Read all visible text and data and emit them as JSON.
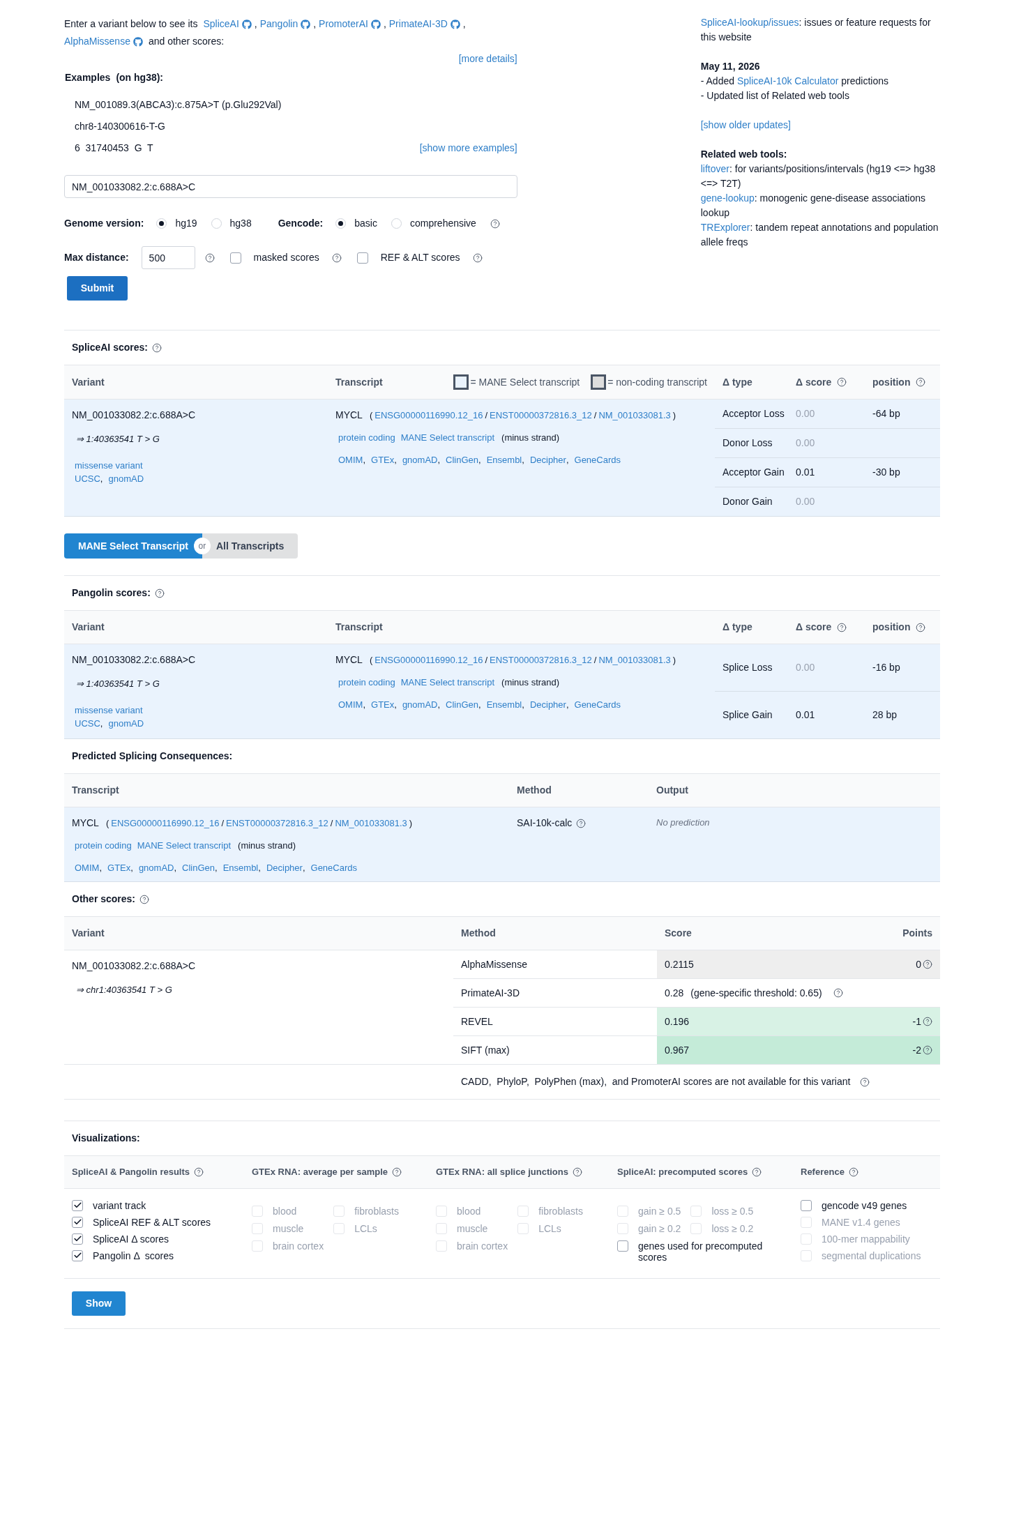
{
  "intro": {
    "lead": "Enter a variant below to see its",
    "tools": [
      {
        "label": "SpliceAI",
        "after": ","
      },
      {
        "label": "Pangolin",
        "after": ","
      },
      {
        "label": "PromoterAI",
        "after": ","
      },
      {
        "label": "PrimateAI-3D",
        "after": ","
      },
      {
        "label": "AlphaMissense"
      }
    ],
    "tail": "and other scores:",
    "more_link": "[more details]"
  },
  "examples": {
    "title": "Examples",
    "note": "(on hg38):",
    "items": [
      "NM_001089.3(ABCA3):c.875A>T (p.Glu292Val)",
      "chr8-140300616-T-G",
      "6  31740453  G  T"
    ],
    "more_link": "[show more examples]"
  },
  "variant_input": {
    "value": "NM_001033082.2:c.688A>C"
  },
  "genome_version": {
    "label": "Genome version:",
    "options": [
      {
        "label": "hg19",
        "selected": true
      },
      {
        "label": "hg38",
        "selected": false
      }
    ]
  },
  "gencode": {
    "label": "Gencode:",
    "options": [
      {
        "label": "basic",
        "selected": true
      },
      {
        "label": "comprehensive",
        "selected": false
      }
    ]
  },
  "max_distance": {
    "label": "Max distance:",
    "value": "500"
  },
  "options": [
    {
      "label": "masked scores",
      "checked": false
    },
    {
      "label": "REF & ALT scores",
      "checked": false
    }
  ],
  "submit": "Submit",
  "sidebar": {
    "issues": {
      "link": "SpliceAI-lookup/issues",
      "text": ": issues or feature requests for this website"
    },
    "update": {
      "date": "May 11, 2026",
      "lines": [
        {
          "prefix": "- Added ",
          "link": "SpliceAI-10k Calculator",
          "suffix": " predictions"
        },
        {
          "prefix": "- Updated list of Related web tools"
        }
      ]
    },
    "older_link": "[show older updates]",
    "related": {
      "title": "Related web tools:",
      "items": [
        {
          "link": "liftover",
          "text": ": for variants/positions/intervals (hg19 <=> hg38 <=> T2T)"
        },
        {
          "link": "gene-lookup",
          "text": ": monogenic gene-disease associations lookup"
        },
        {
          "link": "TRExplorer",
          "text": ": tandem repeat annotations and population allele freqs"
        }
      ]
    }
  },
  "spliceai": {
    "title": "SpliceAI scores:",
    "columns": [
      "Variant",
      "Transcript",
      "Δ type",
      "Δ score",
      "position"
    ],
    "legend": [
      {
        "kind": "mane",
        "label": "= MANE Select transcript"
      },
      {
        "kind": "noncoding",
        "label": "= non-coding transcript"
      }
    ],
    "variant": {
      "name": "NM_001033082.2:c.688A>C",
      "coords": "⇒ 1:40363541 T > G",
      "consequence": "missense variant",
      "links": [
        {
          "label": "UCSC",
          "after": ","
        },
        {
          "label": "gnomAD"
        }
      ]
    },
    "transcript": {
      "gene": "MYCL",
      "open": "(",
      "ids": [
        {
          "label": "ENSG00000116990.12_16",
          "after": "/"
        },
        {
          "label": "ENST00000372816.3_12",
          "after": "/"
        },
        {
          "label": "NM_001033081.3",
          "after": ")"
        }
      ],
      "tags": [
        "protein coding",
        "MANE Select transcript"
      ],
      "strand": "(minus strand)",
      "links": [
        {
          "label": "OMIM",
          "after": ","
        },
        {
          "label": "GTEx",
          "after": ","
        },
        {
          "label": "gnomAD",
          "after": ","
        },
        {
          "label": "ClinGen",
          "after": ","
        },
        {
          "label": "Ensembl",
          "after": ","
        },
        {
          "label": "Decipher",
          "after": ","
        },
        {
          "label": "GeneCards"
        }
      ]
    },
    "rows": [
      {
        "type": "Acceptor Loss",
        "score": "0.00",
        "dim": true,
        "position": "-64 bp"
      },
      {
        "type": "Donor Loss",
        "score": "0.00",
        "dim": true
      },
      {
        "type": "Acceptor Gain",
        "score": "0.01",
        "dim": false,
        "position": "-30 bp"
      },
      {
        "type": "Donor Gain",
        "score": "0.00",
        "dim": true
      }
    ]
  },
  "transcript_toggle": {
    "or": "or",
    "options": [
      {
        "label": "MANE Select Transcript",
        "selected": true
      },
      {
        "label": "All Transcripts",
        "selected": false
      }
    ]
  },
  "pangolin": {
    "title": "Pangolin scores:",
    "columns": [
      "Variant",
      "Transcript",
      "Δ type",
      "Δ score",
      "position"
    ],
    "variant": {
      "name": "NM_001033082.2:c.688A>C",
      "coords": "⇒ 1:40363541 T > G",
      "consequence": "missense variant",
      "links": [
        {
          "label": "UCSC",
          "after": ","
        },
        {
          "label": "gnomAD"
        }
      ]
    },
    "transcript": {
      "gene": "MYCL",
      "open": "(",
      "ids": [
        {
          "label": "ENSG00000116990.12_16",
          "after": "/"
        },
        {
          "label": "ENST00000372816.3_12",
          "after": "/"
        },
        {
          "label": "NM_001033081.3",
          "after": ")"
        }
      ],
      "tags": [
        "protein coding",
        "MANE Select transcript"
      ],
      "strand": "(minus strand)",
      "links": [
        {
          "label": "OMIM",
          "after": ","
        },
        {
          "label": "GTEx",
          "after": ","
        },
        {
          "label": "gnomAD",
          "after": ","
        },
        {
          "label": "ClinGen",
          "after": ","
        },
        {
          "label": "Ensembl",
          "after": ","
        },
        {
          "label": "Decipher",
          "after": ","
        },
        {
          "label": "GeneCards"
        }
      ]
    },
    "rows": [
      {
        "type": "Splice Loss",
        "score": "0.00",
        "dim": true,
        "position": "-16 bp"
      },
      {
        "type": "Splice Gain",
        "score": "0.01",
        "dim": false,
        "position": "28 bp"
      }
    ]
  },
  "consequences": {
    "title": "Predicted Splicing Consequences:",
    "columns": [
      "Transcript",
      "Method",
      "Output"
    ],
    "transcript": {
      "gene": "MYCL",
      "open": "(",
      "ids": [
        {
          "label": "ENSG00000116990.12_16",
          "after": "/"
        },
        {
          "label": "ENST00000372816.3_12",
          "after": "/"
        },
        {
          "label": "NM_001033081.3",
          "after": ")"
        }
      ],
      "tags": [
        "protein coding",
        "MANE Select transcript"
      ],
      "strand": "(minus strand)",
      "links": [
        {
          "label": "OMIM",
          "after": ","
        },
        {
          "label": "GTEx",
          "after": ","
        },
        {
          "label": "gnomAD",
          "after": ","
        },
        {
          "label": "ClinGen",
          "after": ","
        },
        {
          "label": "Ensembl",
          "after": ","
        },
        {
          "label": "Decipher",
          "after": ","
        },
        {
          "label": "GeneCards"
        }
      ]
    },
    "method": "SAI-10k-calc",
    "output": "No prediction"
  },
  "other_scores": {
    "title": "Other scores:",
    "columns": [
      "Variant",
      "Method",
      "Score",
      "Points"
    ],
    "variant": {
      "name": "NM_001033082.2:c.688A>C",
      "coords": "⇒ chr1:40363541 T > G"
    },
    "rows": [
      {
        "kind": "points",
        "method": "AlphaMissense",
        "score": "0.2115",
        "points": "0",
        "color": "#eeeeee"
      },
      {
        "kind": "threshold",
        "method": "PrimateAI-3D",
        "score": "0.28",
        "note": "(gene-specific threshold: 0.65)"
      },
      {
        "kind": "points",
        "method": "REVEL",
        "score": "0.196",
        "points": "-1",
        "color": "#d8f2e5"
      },
      {
        "kind": "points",
        "method": "SIFT (max)",
        "score": "0.967",
        "points": "-2",
        "color": "#c4ebd8"
      }
    ],
    "footnote": "CADD,  PhyloP,  PolyPhen (max),  and PromoterAI scores are not available for this variant"
  },
  "visualizations": {
    "title": "Visualizations:",
    "groups": [
      {
        "title": "SpliceAI & Pangolin results",
        "kind": "list",
        "options": [
          {
            "label": "variant track",
            "checked": true,
            "disabled": false
          },
          {
            "label": "SpliceAI REF & ALT scores",
            "checked": true,
            "disabled": false
          },
          {
            "label": "SpliceAI Δ scores",
            "checked": true,
            "disabled": false
          },
          {
            "label": "Pangolin Δ  scores",
            "checked": true,
            "disabled": false
          }
        ]
      },
      {
        "title": "GTEx RNA: average per sample",
        "kind": "grid",
        "options": [
          {
            "label": "blood",
            "checked": false,
            "disabled": true
          },
          {
            "label": "fibroblasts",
            "checked": false,
            "disabled": true
          },
          {
            "label": "muscle",
            "checked": false,
            "disabled": true
          },
          {
            "label": "LCLs",
            "checked": false,
            "disabled": true
          },
          {
            "label": "brain cortex",
            "checked": false,
            "disabled": true
          }
        ]
      },
      {
        "title": "GTEx RNA: all splice junctions",
        "kind": "grid",
        "options": [
          {
            "label": "blood",
            "checked": false,
            "disabled": true
          },
          {
            "label": "fibroblasts",
            "checked": false,
            "disabled": true
          },
          {
            "label": "muscle",
            "checked": false,
            "disabled": true
          },
          {
            "label": "LCLs",
            "checked": false,
            "disabled": true
          },
          {
            "label": "brain cortex",
            "checked": false,
            "disabled": true
          }
        ]
      },
      {
        "title": "SpliceAI: precomputed scores",
        "kind": "grid",
        "options": [
          {
            "label": "gain ≥ 0.5",
            "checked": false,
            "disabled": true
          },
          {
            "label": "loss ≥ 0.5",
            "checked": false,
            "disabled": true
          },
          {
            "label": "gain ≥ 0.2",
            "checked": false,
            "disabled": true
          },
          {
            "label": "loss ≥ 0.2",
            "checked": false,
            "disabled": true
          },
          {
            "label": "genes used for precomputed scores",
            "checked": false,
            "disabled": false,
            "wide": true
          }
        ]
      },
      {
        "title": "Reference",
        "kind": "list",
        "options": [
          {
            "label": "gencode v49 genes",
            "checked": false,
            "disabled": false
          },
          {
            "label": "MANE v1.4 genes",
            "checked": false,
            "disabled": true
          },
          {
            "label": "100-mer mappability",
            "checked": false,
            "disabled": true
          },
          {
            "label": "segmental duplications",
            "checked": false,
            "disabled": true
          }
        ]
      }
    ],
    "show": "Show"
  }
}
